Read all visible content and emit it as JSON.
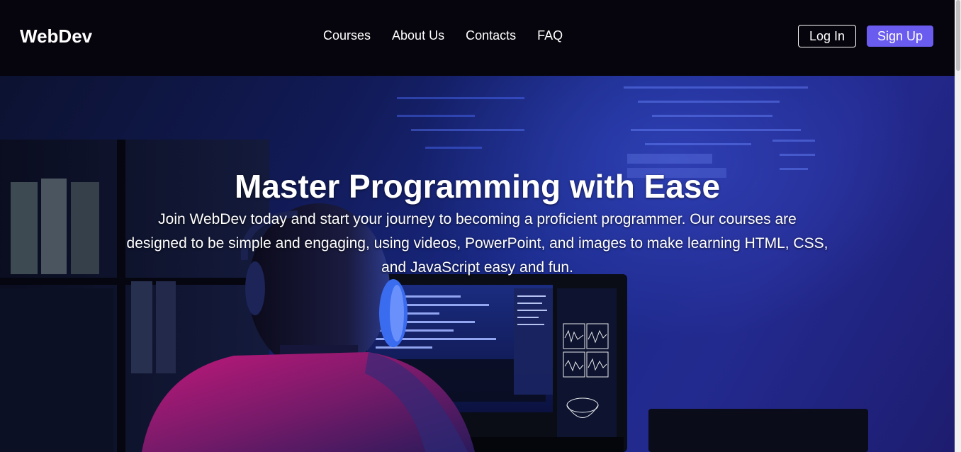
{
  "header": {
    "logo": "WebDev",
    "nav": [
      "Courses",
      "About Us",
      "Contacts",
      "FAQ"
    ],
    "login_label": "Log In",
    "signup_label": "Sign Up"
  },
  "hero": {
    "title": "Master Programming with Ease",
    "text": "Join WebDev today and start your journey to becoming a proficient programmer. Our courses are designed to be simple and engaging, using videos, PowerPoint, and images to make learning HTML, CSS, and JavaScript easy and fun."
  },
  "colors": {
    "header_bg": "#06040c",
    "accent": "#6b5cf0",
    "text": "#ffffff"
  }
}
